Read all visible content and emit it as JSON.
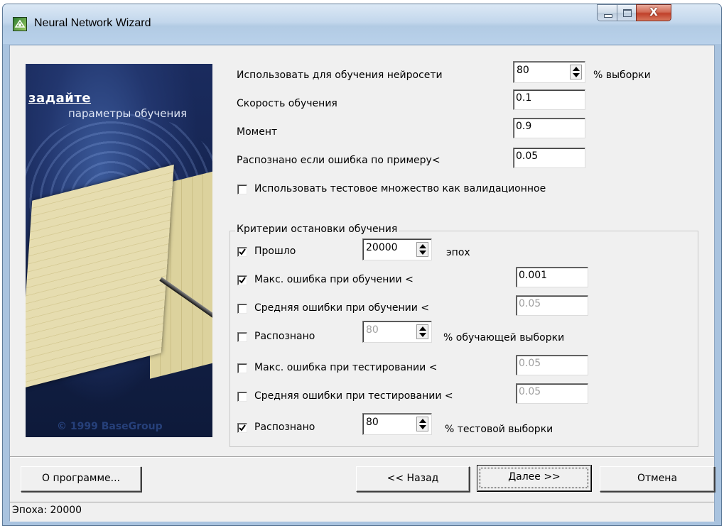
{
  "window": {
    "title": "Neural Network Wizard",
    "close_glyph": "X"
  },
  "banner": {
    "heading": "задайте",
    "subheading": "параметры обучения",
    "copyright": "© 1999 BaseGroup"
  },
  "params": {
    "train_share_label": "Использовать для обучения нейросети",
    "train_share_value": "80",
    "train_share_suffix": "% выборки",
    "learning_rate_label": "Скорость обучения",
    "learning_rate_value": "0.1",
    "momentum_label": "Момент",
    "momentum_value": "0.9",
    "recognized_error_label": "Распознано если ошибка по примеру<",
    "recognized_error_value": "0.05",
    "use_test_as_validation_label": "Использовать тестовое множество как валидационное",
    "use_test_as_validation_checked": false
  },
  "stop_criteria": {
    "title": "Критерии остановки обучения",
    "epochs_label": "Прошло",
    "epochs_checked": true,
    "epochs_value": "20000",
    "epochs_suffix": "эпох",
    "max_train_error_label": "Макс. ошибка при обучении <",
    "max_train_error_checked": true,
    "max_train_error_value": "0.001",
    "avg_train_error_label": "Средняя ошибки при обучении <",
    "avg_train_error_checked": false,
    "avg_train_error_value": "0.05",
    "recognized_train_label": "Распознано",
    "recognized_train_checked": false,
    "recognized_train_value": "80",
    "recognized_train_suffix": "% обучающей выборки",
    "max_test_error_label": "Макс. ошибка при тестировании <",
    "max_test_error_checked": false,
    "max_test_error_value": "0.05",
    "avg_test_error_label": "Средняя ошибки при тестировании <",
    "avg_test_error_checked": false,
    "avg_test_error_value": "0.05",
    "recognized_test_label": "Распознано",
    "recognized_test_checked": true,
    "recognized_test_value": "80",
    "recognized_test_suffix": "% тестовой выборки"
  },
  "buttons": {
    "about": "О программе...",
    "back": "<< Назад",
    "next": "Далее >>",
    "cancel": "Отмена"
  },
  "status": {
    "text": "Эпоха: 20000"
  },
  "colors": {
    "window_frame": "#a9c3df",
    "dialog_bg": "#f0f0f0",
    "banner_bg": "#14234d",
    "close_button": "#c0402a"
  },
  "icons": [
    "app-icon",
    "minimize-icon",
    "maximize-icon",
    "close-icon",
    "checkmark-icon",
    "spin-arrows-icon"
  ]
}
